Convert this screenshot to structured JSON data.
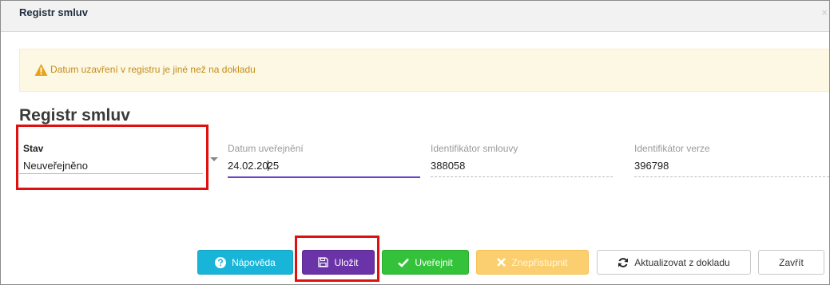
{
  "window": {
    "title": "Registr smluv",
    "close_glyph": "×"
  },
  "alert": {
    "icon": "warning-icon",
    "color": "#c68b1c",
    "message": "Datum uzavření v registru je jiné než na dokladu"
  },
  "section": {
    "heading": "Registr smluv"
  },
  "fields": {
    "stav": {
      "label": "Stav",
      "value": "Neuveřejněno"
    },
    "datum": {
      "label": "Datum uveřejnění",
      "value_before_cursor": "24.02.20",
      "value_after_cursor": "25"
    },
    "identifikator_smlouvy": {
      "label": "Identifikátor smlouvy",
      "value": "388058"
    },
    "identifikator_verze": {
      "label": "Identifikátor verze",
      "value": "396798"
    }
  },
  "buttons": {
    "help": {
      "label": "Nápověda",
      "icon": "question-circle-icon"
    },
    "save": {
      "label": "Uložit",
      "icon": "floppy-disk-icon"
    },
    "publish": {
      "label": "Uveřejnit",
      "icon": "checkmark-icon"
    },
    "unpublish": {
      "label": "Znepřístupnit",
      "icon": "x-icon"
    },
    "update": {
      "label": "Aktualizovat z dokladu",
      "icon": "refresh-icon"
    },
    "close": {
      "label": "Zavřít"
    }
  },
  "colors": {
    "accent_purple": "#6a33a8",
    "help_blue": "#19b5d9",
    "publish_green": "#33c23a",
    "unpublish_yellow": "#fbcf6f",
    "highlight_red": "#e01010"
  }
}
